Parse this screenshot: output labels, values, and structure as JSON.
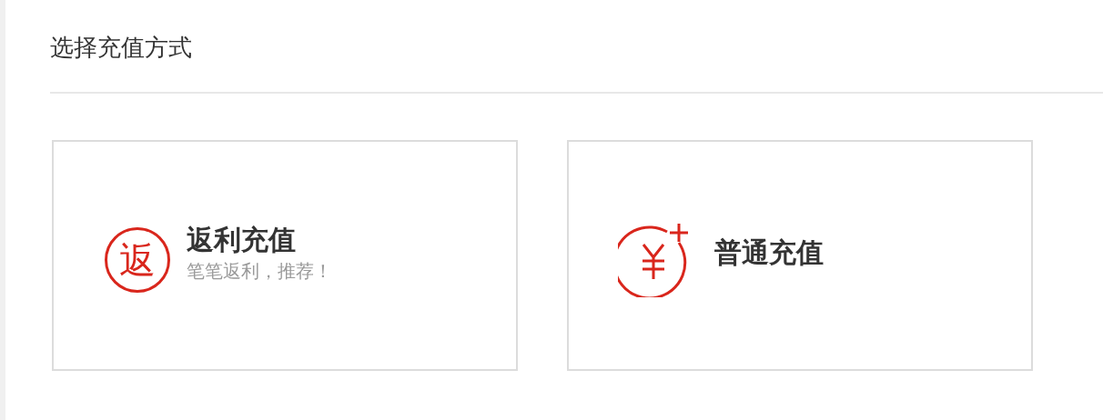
{
  "title": "选择充值方式",
  "options": [
    {
      "kind": "badge",
      "badge": "返",
      "name": "返利充值",
      "subtitle": "笔笔返利，推荐！"
    },
    {
      "kind": "yen",
      "name": "普通充值"
    }
  ]
}
